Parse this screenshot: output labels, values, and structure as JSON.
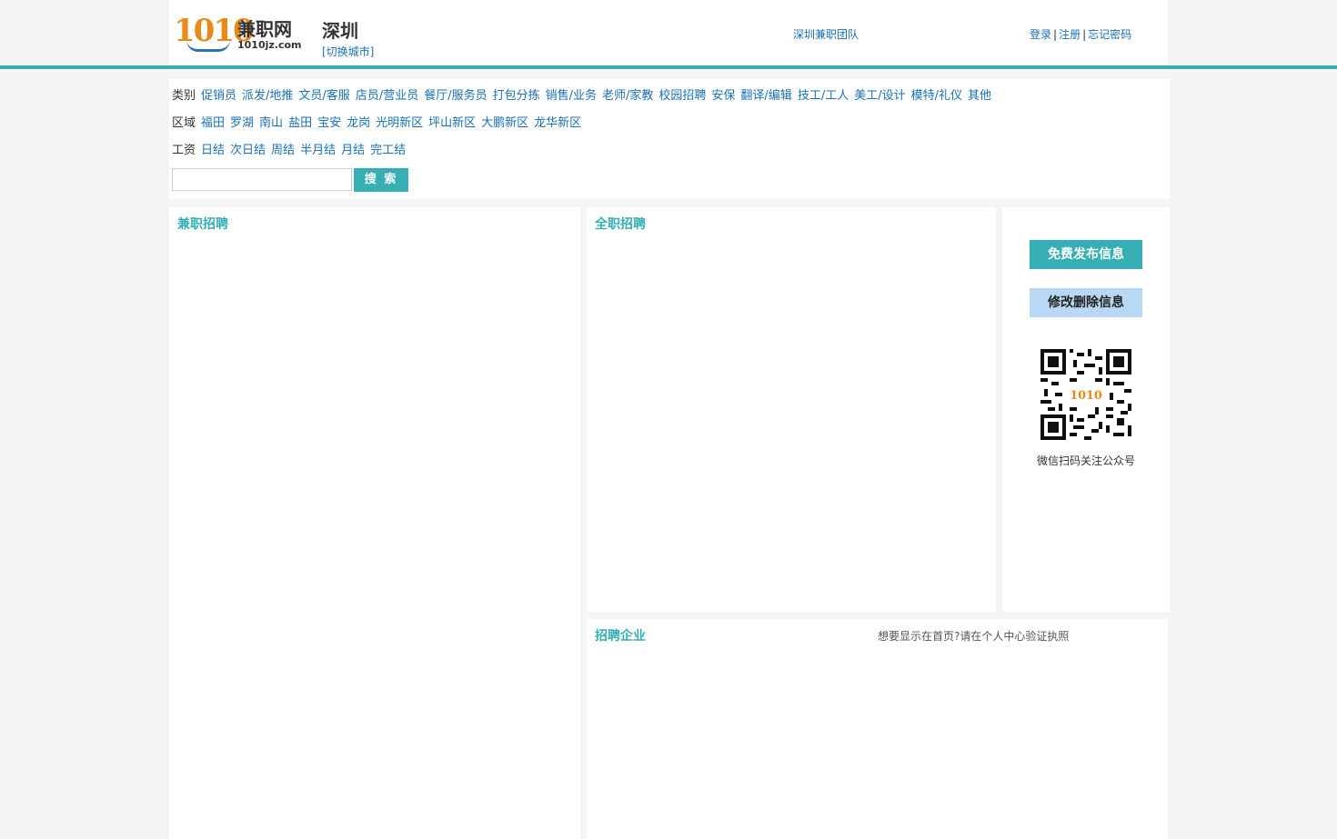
{
  "header": {
    "logo_number": "1010",
    "logo_name": "兼职网",
    "logo_domain": "1010jz.com",
    "city": "深圳",
    "switch_city": "[切换城市]",
    "team_link": "深圳兼职团队",
    "login": "登录",
    "register": "注册",
    "forgot_password": "忘记密码",
    "separator": "|"
  },
  "filters": {
    "category": {
      "label": "类别",
      "items": [
        "促销员",
        "派发/地推",
        "文员/客服",
        "店员/营业员",
        "餐厅/服务员",
        "打包分拣",
        "销售/业务",
        "老师/家教",
        "校园招聘",
        "安保",
        "翻译/编辑",
        "技工/工人",
        "美工/设计",
        "模特/礼仪",
        "其他"
      ]
    },
    "area": {
      "label": "区域",
      "items": [
        "福田",
        "罗湖",
        "南山",
        "盐田",
        "宝安",
        "龙岗",
        "光明新区",
        "坪山新区",
        "大鹏新区",
        "龙华新区"
      ]
    },
    "salary": {
      "label": "工资",
      "items": [
        "日结",
        "次日结",
        "周结",
        "半月结",
        "月结",
        "完工结"
      ]
    }
  },
  "search": {
    "button": "搜 索",
    "value": ""
  },
  "panels": {
    "part_time": "兼职招聘",
    "full_time": "全职招聘",
    "enterprises": "招聘企业",
    "enterprise_hint": "想要显示在首页?请在个人中心验证执照"
  },
  "sidebar": {
    "publish": "免费发布信息",
    "modify": "修改删除信息",
    "qr_caption": "微信扫码关注公众号",
    "qr_center_text": "1010"
  },
  "colors": {
    "accent": "#35aeb4",
    "link": "#1a6fb5",
    "modify_bg": "#b9d8f5"
  }
}
